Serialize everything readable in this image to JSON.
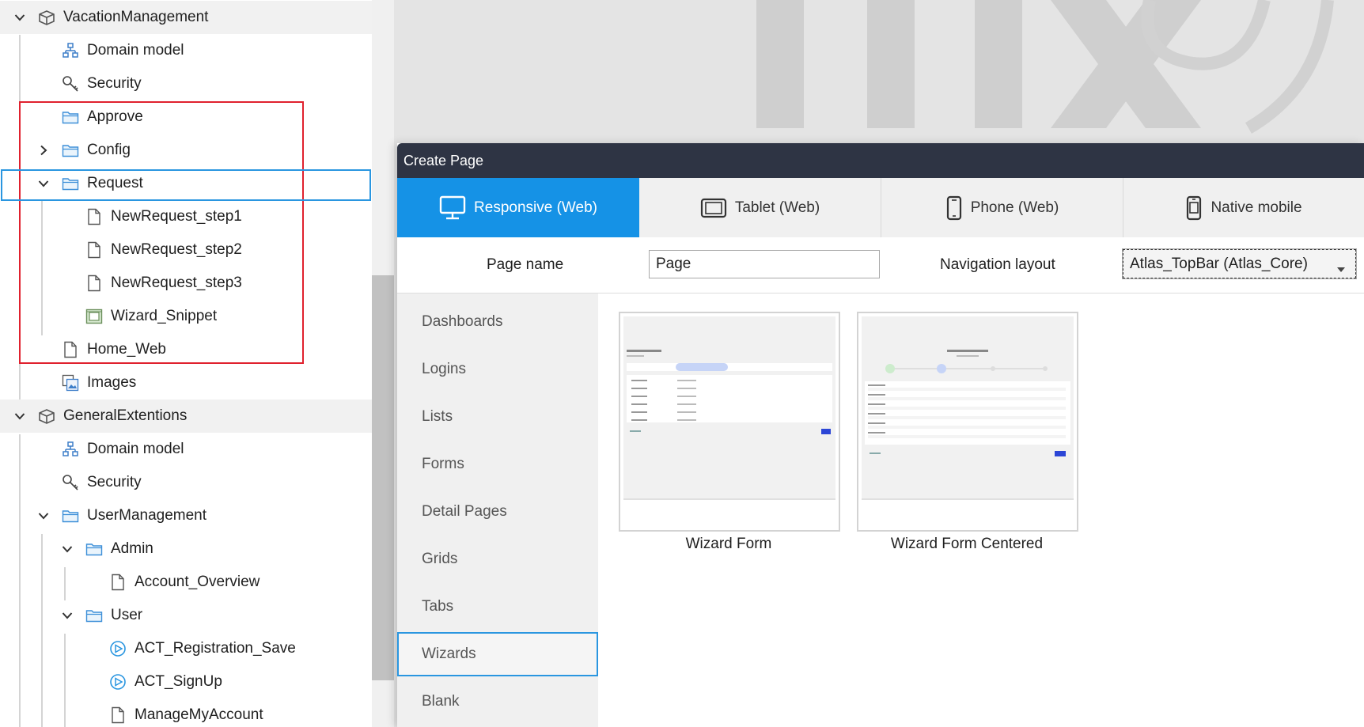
{
  "tree": {
    "items": [
      {
        "label": "VacationManagement",
        "icon": "module-icon",
        "chevron": "expanded"
      },
      {
        "label": "Domain model",
        "icon": "domain-model-icon"
      },
      {
        "label": "Security",
        "icon": "security-key-icon"
      },
      {
        "label": "Approve",
        "icon": "folder-icon"
      },
      {
        "label": "Config",
        "icon": "folder-icon",
        "chevron": "collapsed"
      },
      {
        "label": "Request",
        "icon": "folder-icon",
        "chevron": "expanded"
      },
      {
        "label": "NewRequest_step1",
        "icon": "page-icon"
      },
      {
        "label": "NewRequest_step2",
        "icon": "page-icon"
      },
      {
        "label": "NewRequest_step3",
        "icon": "page-icon"
      },
      {
        "label": "Wizard_Snippet",
        "icon": "snippet-icon"
      },
      {
        "label": "Home_Web",
        "icon": "page-icon"
      },
      {
        "label": "Images",
        "icon": "images-icon"
      },
      {
        "label": "GeneralExtentions",
        "icon": "module-icon",
        "chevron": "expanded"
      },
      {
        "label": "Domain model",
        "icon": "domain-model-icon"
      },
      {
        "label": "Security",
        "icon": "security-key-icon"
      },
      {
        "label": "UserManagement",
        "icon": "folder-icon",
        "chevron": "expanded"
      },
      {
        "label": "Admin",
        "icon": "folder-icon",
        "chevron": "expanded"
      },
      {
        "label": "Account_Overview",
        "icon": "page-icon"
      },
      {
        "label": "User",
        "icon": "folder-icon",
        "chevron": "expanded"
      },
      {
        "label": "ACT_Registration_Save",
        "icon": "microflow-icon"
      },
      {
        "label": "ACT_SignUp",
        "icon": "microflow-icon"
      },
      {
        "label": "ManageMyAccount",
        "icon": "page-icon"
      }
    ]
  },
  "dialog": {
    "title": "Create Page",
    "tabs": [
      {
        "label": "Responsive (Web)",
        "icon": "monitor-icon",
        "active": true
      },
      {
        "label": "Tablet (Web)",
        "icon": "tablet-icon"
      },
      {
        "label": "Phone (Web)",
        "icon": "phone-icon"
      },
      {
        "label": "Native mobile",
        "icon": "native-mobile-icon"
      }
    ],
    "page_name_label": "Page name",
    "page_name_value": "Page",
    "nav_layout_label": "Navigation layout",
    "nav_layout_value": "Atlas_TopBar (Atlas_Core)",
    "categories": [
      "Dashboards",
      "Logins",
      "Lists",
      "Forms",
      "Detail Pages",
      "Grids",
      "Tabs",
      "Wizards",
      "Blank"
    ],
    "selected_category": "Wizards",
    "templates": [
      {
        "label": "Wizard Form"
      },
      {
        "label": "Wizard Form Centered"
      }
    ]
  },
  "colors": {
    "accent": "#1592e6",
    "title_bar": "#2e3444",
    "highlight_red": "#e0212e",
    "selection_blue": "#2a96e0"
  }
}
